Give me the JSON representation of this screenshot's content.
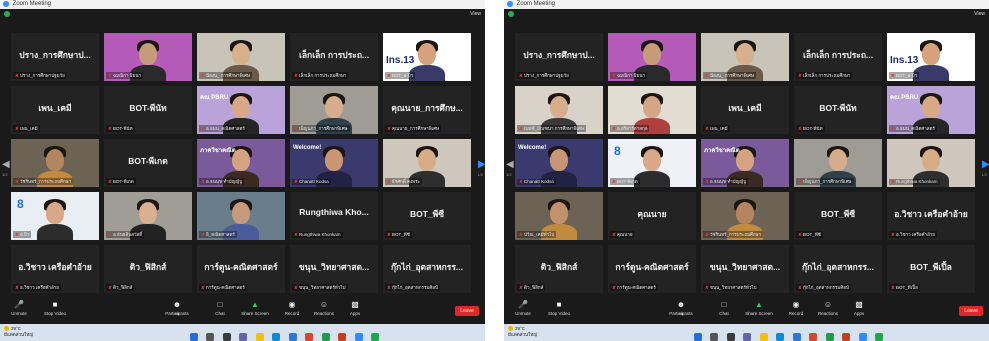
{
  "window": {
    "title": "Zoom Meeting",
    "view_label": "View"
  },
  "left": {
    "tiles": [
      {
        "name": "ปราง_การศึกษาป...",
        "label": "ปราง_การศึกษาปฐมวัย",
        "type": "name"
      },
      {
        "name": "",
        "label": "ฉมณิกา ธิมนา",
        "type": "video",
        "bg": "#b45ab8",
        "skin": "#c79a7a",
        "shirt": "#2a2a2a"
      },
      {
        "name": "",
        "label": "น้องน_ การศึกษาพิเศษ",
        "type": "video",
        "bg": "#c9c4b8",
        "skin": "#d9b08c",
        "shirt": "#6b5a48"
      },
      {
        "name": "เล็กเล็ก การประถ...",
        "label": "เล็กเล็ก การประถมศึกษา",
        "type": "name"
      },
      {
        "name": "",
        "label": "BOT_อ.บิว",
        "type": "video",
        "bg": "#ffffff",
        "skin": "#d6a27c",
        "shirt": "#3a3a6a",
        "speaking": true,
        "ins": "Ins.13"
      },
      {
        "name": "เพน_เคมี",
        "label": "เพน_เคมี",
        "type": "name"
      },
      {
        "name": "BOT-พีนัท",
        "label": "BOT-พีนัท",
        "type": "name"
      },
      {
        "name": "",
        "label": "อ.ธมน_คณิตศาสตร์",
        "type": "video",
        "bg": "#b9a3d9",
        "skin": "#d7a988",
        "shirt": "#262626",
        "banner": "คณ PBRU"
      },
      {
        "name": "",
        "label": "เพ็ญนภา_การศึกษาพิเศษ",
        "type": "video",
        "bg": "#9f9c95",
        "skin": "#d6ad8c",
        "shirt": "#30404a"
      },
      {
        "name": "คุณนาย_การศึกษ...",
        "label": "คุณนาย_การศึกษาพิเศษ",
        "type": "name"
      },
      {
        "name": "",
        "label": "วัชรินทร์_การประถมศึกษา",
        "type": "video",
        "bg": "#6c6355",
        "skin": "#b4865f",
        "shirt": "#c28a40"
      },
      {
        "name": "BOT-พีเกด",
        "label": "BOT-พีเกด",
        "type": "name"
      },
      {
        "name": "",
        "label": "อ.ธนนุช ทำบัญญ์บู",
        "type": "video",
        "bg": "#7a5a9a",
        "skin": "#d4a482",
        "shirt": "#3a2a22",
        "banner": "ภาควิชาคณิต"
      },
      {
        "name": "",
        "label": "Chanatt Kodsa",
        "type": "video",
        "bg": "#3a3a6e",
        "skin": "#c99574",
        "shirt": "#222244",
        "banner": "Welcome!"
      },
      {
        "name": "",
        "label": "ธีรศักดิ์ คงพระ",
        "type": "video",
        "bg": "#cfc7bb",
        "skin": "#d6ac88",
        "shirt": "#2e2e2e"
      },
      {
        "name": "",
        "label": "อ.ปิว",
        "type": "video",
        "bg": "#e9eef3",
        "skin": "#d8a888",
        "shirt": "#2c2c2c",
        "speaking": true,
        "logo": "8"
      },
      {
        "name": "",
        "label": "อ.ธันยสินสวัสดิ์",
        "type": "video",
        "bg": "#a09d96",
        "skin": "#d9b090",
        "shirt": "#222222"
      },
      {
        "name": "",
        "label": "อิ_คณิตศาสตร์",
        "type": "video",
        "bg": "#6a7d8c",
        "skin": "#c69a7a",
        "shirt": "#4a5a9a"
      },
      {
        "name": "Rungthiwa Kho...",
        "label": "Rungthiwa Khonkam",
        "type": "name"
      },
      {
        "name": "BOT_พีซี",
        "label": "BOT_พีซี",
        "type": "name"
      },
      {
        "name": "อ.วิชาว เครือคำอ้าย",
        "label": "อ.วิชาว เครือคำอ้าย",
        "type": "name"
      },
      {
        "name": "ดิว_ฟิสิกส์",
        "label": "ดิว_ฟิสิกส์",
        "type": "name"
      },
      {
        "name": "การ์ตูน-คณิตศาสตร์",
        "label": "การ์ตูน-คณิตศาสตร์",
        "type": "name"
      },
      {
        "name": "ขนุน_วิทยาศาสต...",
        "label": "ขนุน_วิทยาศาสตร์ทั่วไป",
        "type": "name"
      },
      {
        "name": "กุ๊กไก่_อุตสาหกรร...",
        "label": "กุ๊กไก่_อุตสาหกรรมศิลป์",
        "type": "name"
      }
    ]
  },
  "right": {
    "tiles": [
      {
        "name": "ปราง_การศึกษาป...",
        "label": "ปราง_การศึกษาปฐมวัย",
        "type": "name"
      },
      {
        "name": "",
        "label": "ฉมณิกา ธิมนา",
        "type": "video",
        "bg": "#b45ab8",
        "skin": "#c79a7a",
        "shirt": "#2a2a2a"
      },
      {
        "name": "",
        "label": "น้องน_ การศึกษาพิเศษ",
        "type": "video",
        "bg": "#c9c4b8",
        "skin": "#d9b08c",
        "shirt": "#6b5a48"
      },
      {
        "name": "เล็กเล็ก การประถ...",
        "label": "เล็กเล็ก การประถมศึกษา",
        "type": "name"
      },
      {
        "name": "",
        "label": "BOT_อ.บิว",
        "type": "video",
        "bg": "#ffffff",
        "skin": "#d6a27c",
        "shirt": "#3a3a6a",
        "speaking": true,
        "ins": "Ins.13"
      },
      {
        "name": "",
        "label": "เบนซ์_มัณฑนา การศึกษาพิเศษ",
        "type": "video",
        "bg": "#d8d2c8",
        "skin": "#d7ad8d",
        "shirt": "#3a3a3a"
      },
      {
        "name": "",
        "label": "อ.อริสาร์ต่าสกุล",
        "type": "video",
        "bg": "#e2ddd3",
        "skin": "#d4a686",
        "shirt": "#b04040"
      },
      {
        "name": "เพน_เคมี",
        "label": "เพน_เคมี",
        "type": "name"
      },
      {
        "name": "BOT-พีนัท",
        "label": "BOT-พีนัท",
        "type": "name"
      },
      {
        "name": "",
        "label": "อ.ธมน_คณิตศาสตร์",
        "type": "video",
        "bg": "#b9a3d9",
        "skin": "#d7a988",
        "shirt": "#262626",
        "banner": "คณ PBRU"
      },
      {
        "name": "",
        "label": "Chanatt Kodsa",
        "type": "video",
        "bg": "#3a3a6e",
        "skin": "#c99574",
        "shirt": "#222244",
        "banner": "Welcome!"
      },
      {
        "name": "",
        "label": "BOT-พีเกด",
        "type": "video",
        "bg": "#eef2f6",
        "skin": "#d8a888",
        "shirt": "#2c2c2c",
        "logo": "8"
      },
      {
        "name": "",
        "label": "อ.ธนนุช ทำบัญญ์บู",
        "type": "video",
        "bg": "#7a5a9a",
        "skin": "#d4a482",
        "shirt": "#3a2a22",
        "banner": "ภาควิชาคณิต"
      },
      {
        "name": "",
        "label": "เพ็ญนภา_การศึกษาพิเศษ",
        "type": "video",
        "bg": "#9f9c95",
        "skin": "#d6ad8c",
        "shirt": "#30404a"
      },
      {
        "name": "",
        "label": "Rungthiwa Khonkam",
        "type": "video",
        "bg": "#cfc7bb",
        "skin": "#d6ac88",
        "shirt": "#2e2e2e"
      },
      {
        "name": "",
        "label": "ปวีณ_เคมีทั่วไป",
        "type": "video",
        "bg": "#6c6355",
        "skin": "#c3926c",
        "shirt": "#c28a40"
      },
      {
        "name": "คุณนาย",
        "label": "คุณนาย",
        "type": "name"
      },
      {
        "name": "",
        "label": "วัชรินทร์_การประถมศึกษา",
        "type": "video",
        "bg": "#6c6355",
        "skin": "#b4865f",
        "shirt": "#c28a40"
      },
      {
        "name": "BOT_พีซี",
        "label": "BOT_พีซี",
        "type": "name"
      },
      {
        "name": "อ.วิชาว เครือคำอ้าย",
        "label": "อ.วิชาว เครือคำอ้าย",
        "type": "name"
      },
      {
        "name": "ดิว_ฟิสิกส์",
        "label": "ดิว_ฟิสิกส์",
        "type": "name"
      },
      {
        "name": "การ์ตูน-คณิตศาสตร์",
        "label": "การ์ตูน-คณิตศาสตร์",
        "type": "name"
      },
      {
        "name": "ขนุน_วิทยาศาสต...",
        "label": "ขนุน_วิทยาศาสตร์ทั่วไป",
        "type": "name"
      },
      {
        "name": "กุ๊กไก่_อุตสาหกรร...",
        "label": "กุ๊กไก่_อุตสาหกรรมศิลป์",
        "type": "name"
      },
      {
        "name": "BOT_พีเปิ้ล",
        "label": "BOT_พีเปิ้ล",
        "type": "name"
      }
    ]
  },
  "page_indicator": "1/2",
  "toolbar": {
    "unmute": "Unmute",
    "stop_video": "Stop Video",
    "participants": "Participants",
    "participants_count": "69",
    "chat": "Chat",
    "share_screen": "Share Screen",
    "record": "Record",
    "reactions": "Reactions",
    "apps": "Apps",
    "leave": "Leave"
  },
  "taskbar": {
    "temperature": "29°C",
    "condition": "มีแดดส่วนใหญ่"
  },
  "colors": {
    "accent": "#2d8cff",
    "share": "#23d160",
    "leave": "#e02828",
    "speaking": "#f5f28a",
    "muted": "#e03a3a"
  }
}
